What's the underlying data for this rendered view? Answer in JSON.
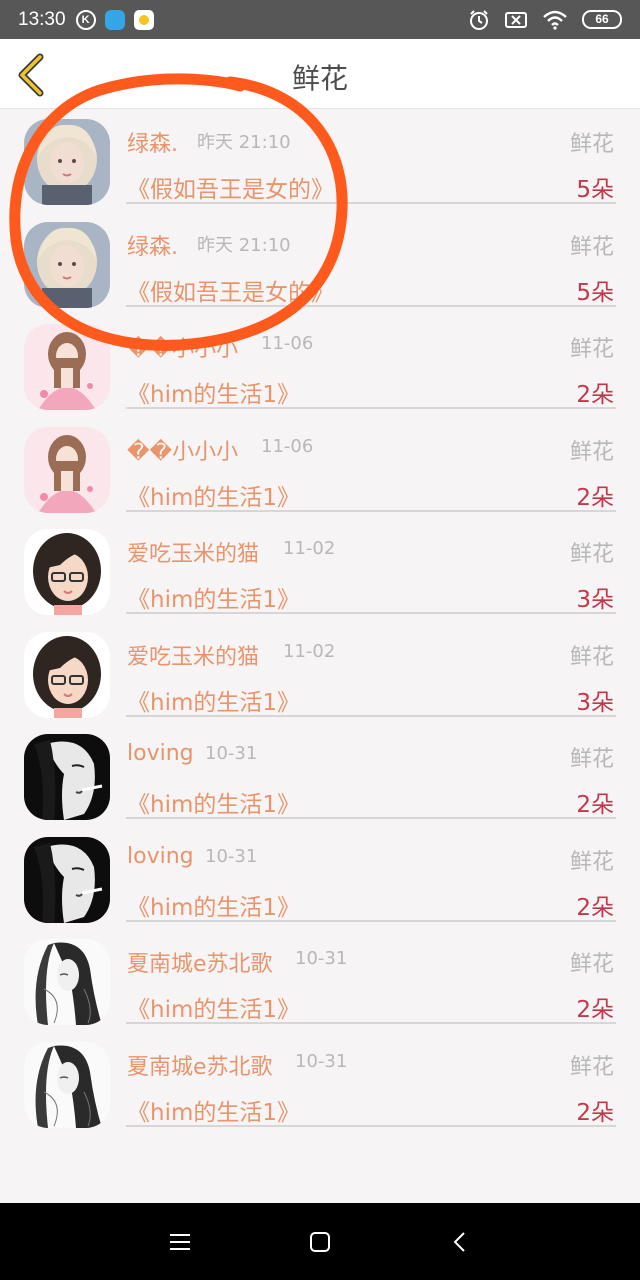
{
  "status_bar": {
    "time": "13:30",
    "k_badge": "K",
    "battery": "66"
  },
  "header": {
    "title": "鲜花"
  },
  "colors": {
    "accent_orange": "#e9946a",
    "count_red": "#c4374a",
    "annotation_orange": "#ff5a1e"
  },
  "records": [
    {
      "name": "绿森.",
      "time": "昨天 21:10",
      "type": "鲜花",
      "book": "《假如吾王是女的》",
      "count": "5朵",
      "avatar": "blonde-girl"
    },
    {
      "name": "绿森.",
      "time": "昨天 21:10",
      "type": "鲜花",
      "book": "《假如吾王是女的》",
      "count": "5朵",
      "avatar": "blonde-girl"
    },
    {
      "name": "��小小小",
      "time": "11-06",
      "type": "鲜花",
      "book": "《him的生活1》",
      "count": "2朵",
      "avatar": "pink-doll"
    },
    {
      "name": "��小小小",
      "time": "11-06",
      "type": "鲜花",
      "book": "《him的生活1》",
      "count": "2朵",
      "avatar": "pink-doll"
    },
    {
      "name": "爱吃玉米的猫",
      "time": "11-02",
      "type": "鲜花",
      "book": "《him的生活1》",
      "count": "3朵",
      "avatar": "glasses-girl"
    },
    {
      "name": "爱吃玉米的猫",
      "time": "11-02",
      "type": "鲜花",
      "book": "《him的生活1》",
      "count": "3朵",
      "avatar": "glasses-girl"
    },
    {
      "name": "loving",
      "time": "10-31",
      "type": "鲜花",
      "book": "《him的生活1》",
      "count": "2朵",
      "avatar": "bw-smoker"
    },
    {
      "name": "loving",
      "time": "10-31",
      "type": "鲜花",
      "book": "《him的生活1》",
      "count": "2朵",
      "avatar": "bw-smoker"
    },
    {
      "name": "夏南城e苏北歌",
      "time": "10-31",
      "type": "鲜花",
      "book": "《him的生活1》",
      "count": "2朵",
      "avatar": "sketch-girl"
    },
    {
      "name": "夏南城e苏北歌",
      "time": "10-31",
      "type": "鲜花",
      "book": "《him的生活1》",
      "count": "2朵",
      "avatar": "sketch-girl"
    }
  ]
}
